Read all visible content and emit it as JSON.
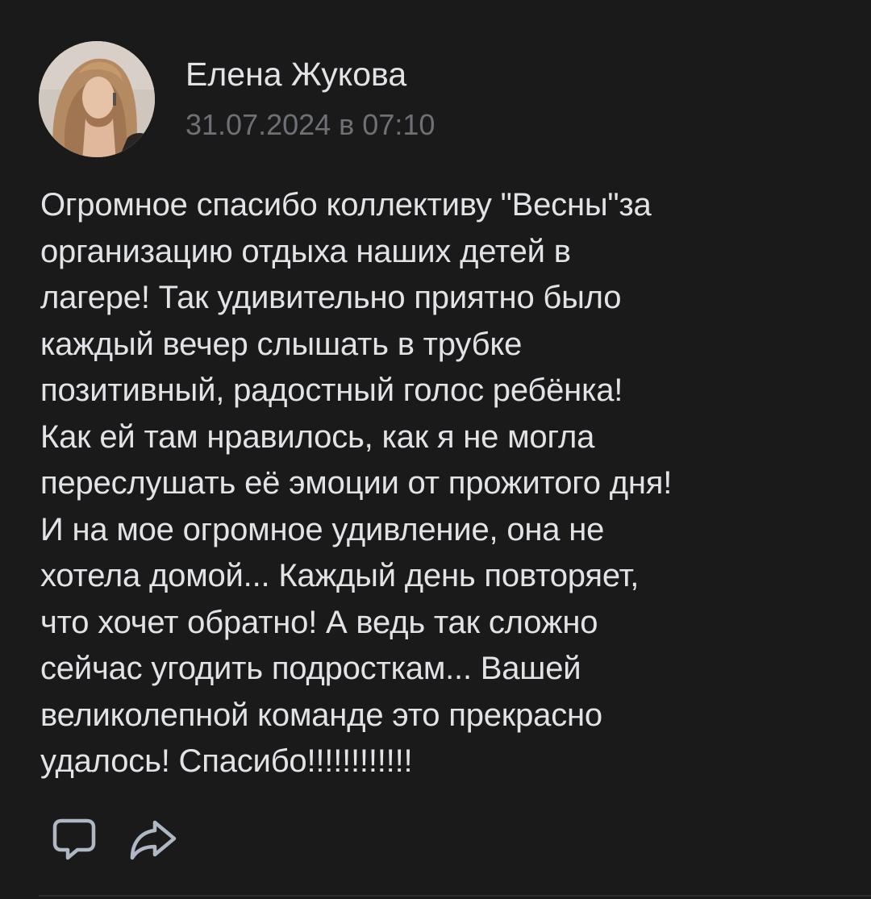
{
  "post": {
    "author": {
      "name": "Елена Жукова",
      "avatar_icon": "avatar-photo"
    },
    "date": "31.07.2024 в 07:10",
    "text_lines": [
      "Огромное спасибо коллективу \"Весны\"за",
      "организацию отдыха наших детей в",
      "лагере! Так удивительно приятно было",
      "каждый вечер слышать в трубке",
      "позитивный, радостный голос ребёнка!",
      "Как ей там нравилось, как я не могла",
      "переслушать её эмоции от прожитого дня!",
      "И на мое огромное удивление, она не",
      "хотела домой... Каждый день повторяет,",
      "что хочет обратно! А ведь так сложно",
      "сейчас угодить подросткам... Вашей",
      "великолепной команде это прекрасно",
      "удалось! Спасибо!!!!!!!!!!!!"
    ],
    "actions": [
      {
        "name": "comment",
        "icon": "comment-icon"
      },
      {
        "name": "share",
        "icon": "share-icon"
      }
    ]
  },
  "colors": {
    "background": "#1a1a1a",
    "text_primary": "#e1e3e6",
    "text_secondary": "#6d7075",
    "icon": "#aeb7c2"
  }
}
